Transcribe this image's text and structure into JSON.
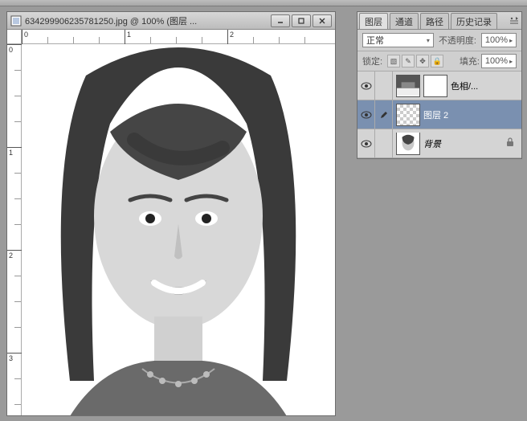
{
  "document": {
    "title": "634299906235781250.jpg @ 100% (图层 ...",
    "ruler": {
      "h": [
        "0",
        "1",
        "2"
      ],
      "v": [
        "0",
        "1",
        "2",
        "3"
      ]
    }
  },
  "panel": {
    "tabs": [
      "图层",
      "通道",
      "路径",
      "历史记录"
    ],
    "active_tab": 0,
    "blend_mode": "正常",
    "opacity_label": "不透明度:",
    "opacity_value": "100%",
    "lock_label": "锁定:",
    "fill_label": "填充:",
    "fill_value": "100%",
    "layers": [
      {
        "name": "色相/...",
        "visible": true,
        "has_mask": true,
        "selected": false,
        "thumb": "gradient",
        "locked": false,
        "italic": false
      },
      {
        "name": "图层 2",
        "visible": true,
        "has_mask": false,
        "selected": true,
        "thumb": "checker",
        "locked": false,
        "italic": false,
        "editing": true
      },
      {
        "name": "背景",
        "visible": true,
        "has_mask": false,
        "selected": false,
        "thumb": "portrait",
        "locked": true,
        "italic": true
      }
    ]
  }
}
